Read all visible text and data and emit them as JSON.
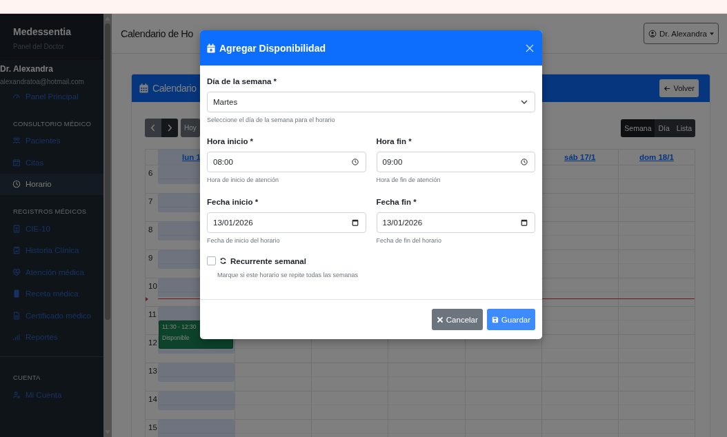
{
  "sidebar": {
    "brand": "Medessentia",
    "subtitle": "Panel del Doctor",
    "user_name": "Dr. Alexandra",
    "user_email": "alexandratoa@hotmail.com",
    "groups": [
      {
        "items": [
          {
            "label": "Panel Principal",
            "selected": false
          }
        ]
      },
      {
        "heading": "CONSULTORIO MÉDICO",
        "items": [
          {
            "label": "Pacientes",
            "selected": false
          },
          {
            "label": "Citas",
            "selected": false
          },
          {
            "label": "Horario",
            "selected": true
          }
        ]
      },
      {
        "heading": "REGISTROS MÉDICOS",
        "items": [
          {
            "label": "CIE-10",
            "selected": false
          },
          {
            "label": "Historia Clínica",
            "selected": false
          },
          {
            "label": "Atención médica",
            "selected": false
          },
          {
            "label": "Receta médica",
            "selected": false
          },
          {
            "label": "Certificado médico",
            "selected": false
          },
          {
            "label": "Reportes",
            "selected": false
          }
        ]
      },
      {
        "heading": "CUENTA",
        "items": [
          {
            "label": "Mi Cuenta",
            "selected": false
          }
        ]
      }
    ]
  },
  "page_header": {
    "title": "Calendario de Ho",
    "user_menu": "Dr. Alexandra"
  },
  "card": {
    "title": "Calendario",
    "back_button": "Volver",
    "today_button": "Hoy",
    "views": [
      {
        "label": "Semana",
        "selected": true
      },
      {
        "label": "Día",
        "selected": false
      },
      {
        "label": "Lista",
        "selected": false
      }
    ],
    "calendar": {
      "days": [
        {
          "label": "lun 1",
          "today": true,
          "events": [
            {
              "time": "11:30 - 12:30",
              "title": "Disponible"
            }
          ]
        },
        {
          "today": false
        },
        {
          "today": false
        },
        {
          "today": false
        },
        {
          "today": false
        },
        {
          "label": "sáb 17/1",
          "today": false
        },
        {
          "label": "dom 18/1",
          "today": false
        }
      ],
      "hours": [
        "6",
        "7",
        "8",
        "9",
        "10",
        "11",
        "12",
        "13",
        "14",
        "15"
      ],
      "now_indicator": true
    }
  },
  "modal": {
    "title": "Agregar Disponibilidad",
    "day": {
      "label": "Día de la semana *",
      "value": "Martes",
      "help": "Seleccione el día de la semana para el horario"
    },
    "fields": [
      {
        "kind": "time",
        "label": "Hora inicio *",
        "value": "08:00",
        "help": "Hora de inicio de atención"
      },
      {
        "kind": "time",
        "label": "Hora fin *",
        "value": "09:00",
        "help": "Hora de fin de atención"
      },
      {
        "kind": "date",
        "label": "Fecha inicio *",
        "value": "13/01/2026",
        "help": "Fecha de inicio del horario"
      },
      {
        "kind": "date",
        "label": "Fecha fin *",
        "value": "13/01/2026",
        "help": "Fecha de fin del horario"
      }
    ],
    "recurring": {
      "label": "Recurrente semanal",
      "help": "Marque si este horario se repite todas las semanas",
      "checked": false
    },
    "cancel_button": "Cancelar",
    "save_button": "Guardar"
  }
}
